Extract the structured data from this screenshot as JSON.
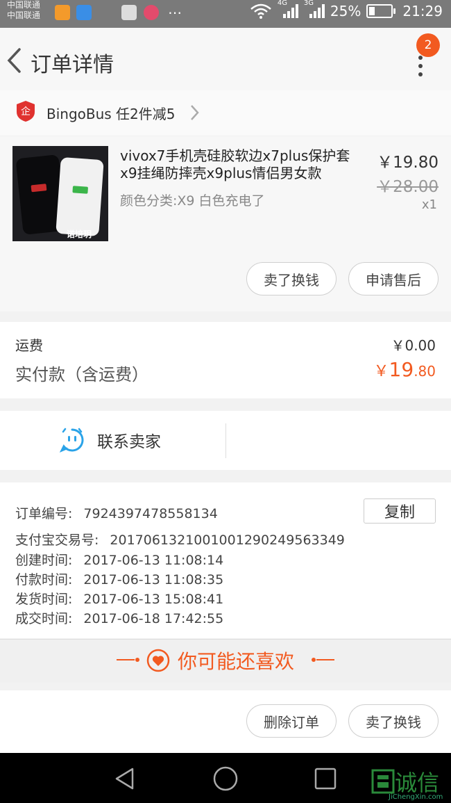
{
  "status_bar": {
    "carrier_line1": "中国联通",
    "carrier_line2": "中国联通",
    "net1": "4G",
    "net2": "3G",
    "battery": "25%",
    "battery_level": 0.25,
    "time": "21:29"
  },
  "header": {
    "title": "订单详情",
    "badge_count": "2"
  },
  "shop": {
    "name": "BingoBus 任2件减5",
    "logo_text": "企"
  },
  "product": {
    "title": "vivox7手机壳硅胶软边x7plus保护套x9挂绳防摔壳x9plus情侣男女款",
    "spec": "颜色分类:X9 白色充电了",
    "price": "￥19.80",
    "original_price": "￥28.00",
    "quantity": "x1",
    "image_caption": "诺培玥",
    "buttons": [
      "卖了换钱",
      "申请售后"
    ]
  },
  "totals": {
    "shipping_label": "运费",
    "shipping_value": "￥0.00",
    "paid_label": "实付款（含运费）",
    "paid_currency": "￥",
    "paid_int": "19",
    "paid_dec": ".80"
  },
  "contact": {
    "label": "联系卖家"
  },
  "order_info": {
    "copy_label": "复制",
    "rows": [
      {
        "key": "订单编号:",
        "value": "7924397478558134"
      },
      {
        "key": "支付宝交易号:",
        "value": "2017061321001001290249563349"
      },
      {
        "key": "创建时间:",
        "value": "2017-06-13 11:08:14"
      },
      {
        "key": "付款时间:",
        "value": "2017-06-13 11:08:35"
      },
      {
        "key": "发货时间:",
        "value": "2017-06-13 15:08:41"
      },
      {
        "key": "成交时间:",
        "value": "2017-06-18 17:42:55"
      }
    ]
  },
  "recommend": {
    "label": "你可能还喜欢"
  },
  "bottom_actions": [
    "删除订单",
    "卖了换钱"
  ],
  "watermark": {
    "text": "诚信",
    "sub": "JiChengXin.com"
  },
  "colors": {
    "accent": "#f25a20",
    "contact_icon": "#2aa3e8"
  }
}
